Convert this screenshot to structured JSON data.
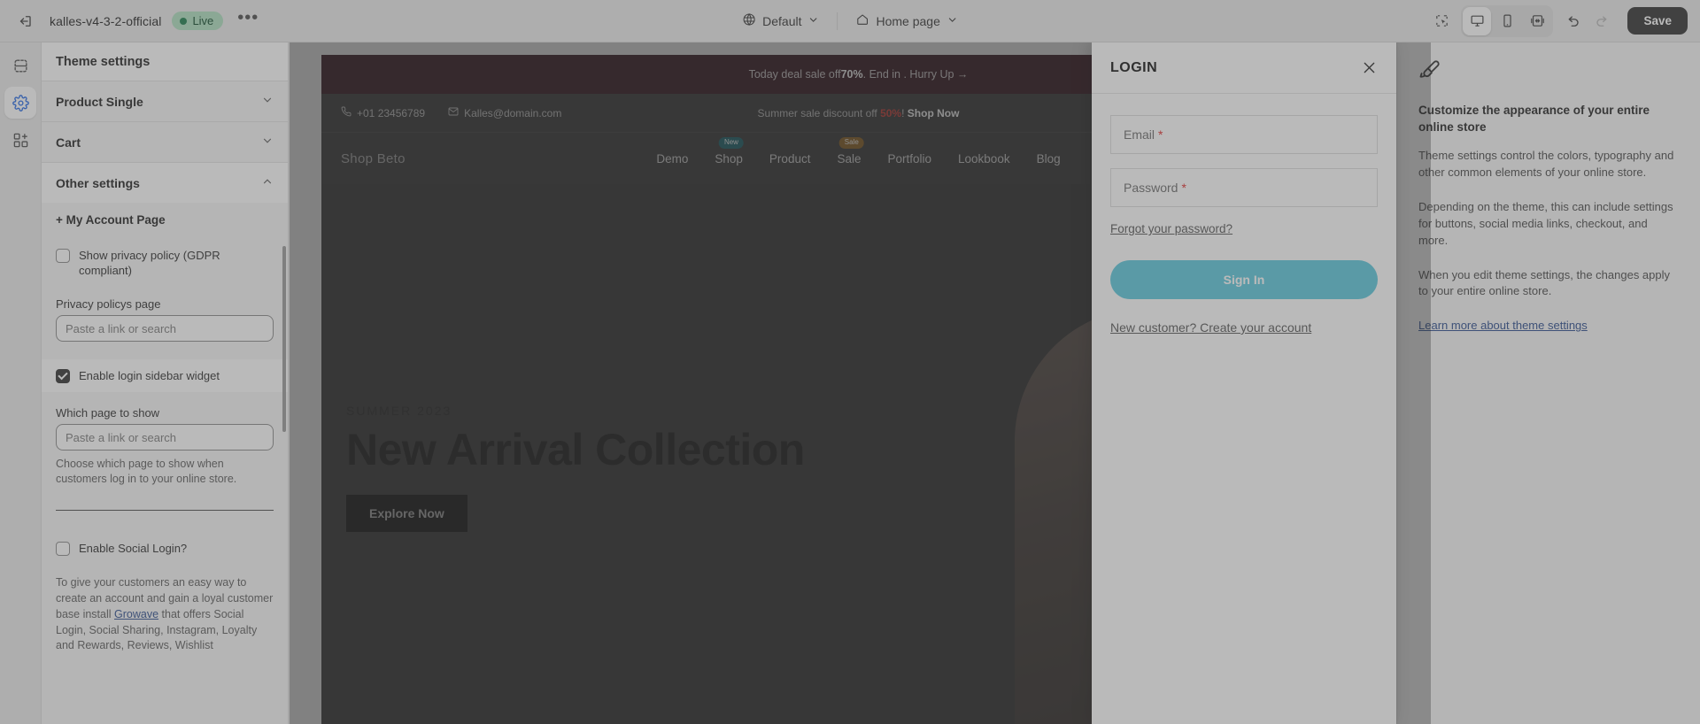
{
  "topbar": {
    "exit_icon": "exit-icon",
    "theme_name": "kalles-v4-3-2-official",
    "live_label": "Live",
    "more_label": "•••",
    "locale_icon": "globe-icon",
    "locale_label": "Default",
    "page_icon": "home-icon",
    "page_label": "Home page",
    "tools": [
      {
        "name": "inspect-icon",
        "label": "Inspect"
      },
      {
        "name": "desktop-icon",
        "label": "Desktop"
      },
      {
        "name": "mobile-icon",
        "label": "Mobile"
      },
      {
        "name": "fullwidth-icon",
        "label": "Full width"
      }
    ],
    "undo_label": "Undo",
    "redo_label": "Redo",
    "save_label": "Save"
  },
  "rail": {
    "items": [
      {
        "name": "sections-icon",
        "label": "Sections"
      },
      {
        "name": "gear-icon",
        "label": "Theme settings"
      },
      {
        "name": "apps-add-icon",
        "label": "Apps"
      }
    ]
  },
  "sidebar": {
    "title": "Theme settings",
    "sections": [
      {
        "label": "Product Single",
        "open": false
      },
      {
        "label": "Cart",
        "open": false
      },
      {
        "label": "Other settings",
        "open": true
      }
    ],
    "other_settings": {
      "sub_head": "+ My Account Page",
      "gdpr_label": "Show privacy policy (GDPR compliant)",
      "privacy_field_label": "Privacy policys page",
      "privacy_placeholder": "Paste a link or search",
      "login_widget_label": "Enable login sidebar widget",
      "which_page_label": "Which page to show",
      "which_page_placeholder": "Paste a link or search",
      "which_page_help": "Choose which page to show when customers log in to your online store.",
      "social_login_label": "Enable Social Login?",
      "social_text_before": "To give your customers an easy way to create an account and gain a loyal customer base install ",
      "social_link": "Growave",
      "social_text_after": " that offers Social Login, Social Sharing, Instagram, Loyalty and Rewards, Reviews, Wishlist"
    }
  },
  "preview": {
    "announcement": {
      "before": "Today deal sale off ",
      "highlight": "70%",
      "after": ". End in . Hurry Up →"
    },
    "topinfo": {
      "phone_icon": "phone-icon",
      "phone": "+01 23456789",
      "mail_icon": "mail-icon",
      "email": "Kalles@domain.com",
      "promo_before": "Summer sale discount off ",
      "promo_percent": "50%",
      "promo_bang": "! ",
      "promo_cta": "Shop Now"
    },
    "nav": {
      "logo": "Shop Beto",
      "items": [
        {
          "label": "Demo",
          "badge": ""
        },
        {
          "label": "Shop",
          "badge": "New",
          "badge_type": "new"
        },
        {
          "label": "Product",
          "badge": ""
        },
        {
          "label": "Sale",
          "badge": "Sale",
          "badge_type": "sale"
        },
        {
          "label": "Portfolio",
          "badge": ""
        },
        {
          "label": "Lookbook",
          "badge": ""
        },
        {
          "label": "Blog",
          "badge": ""
        }
      ]
    },
    "hero": {
      "kicker": "SUMMER 2023",
      "title": "New Arrival Collection",
      "button": "Explore Now"
    }
  },
  "login_modal": {
    "title": "LOGIN",
    "close_icon": "close-icon",
    "email_label": "Email",
    "password_label": "Password",
    "required_mark": "*",
    "forgot_label": "Forgot your password?",
    "signin_label": "Sign In",
    "create_label": "New customer? Create your account",
    "accent_color": "#5ac8dd"
  },
  "info_panel": {
    "icon": "paintbrush-icon",
    "title": "Customize the appearance of your entire online store",
    "p1": "Theme settings control the colors, typography and other common elements of your online store.",
    "p2": "Depending on the theme, this can include settings for buttons, social media links, checkout, and more.",
    "p3": "When you edit theme settings, the changes apply to your entire online store.",
    "link": "Learn more about theme settings"
  }
}
